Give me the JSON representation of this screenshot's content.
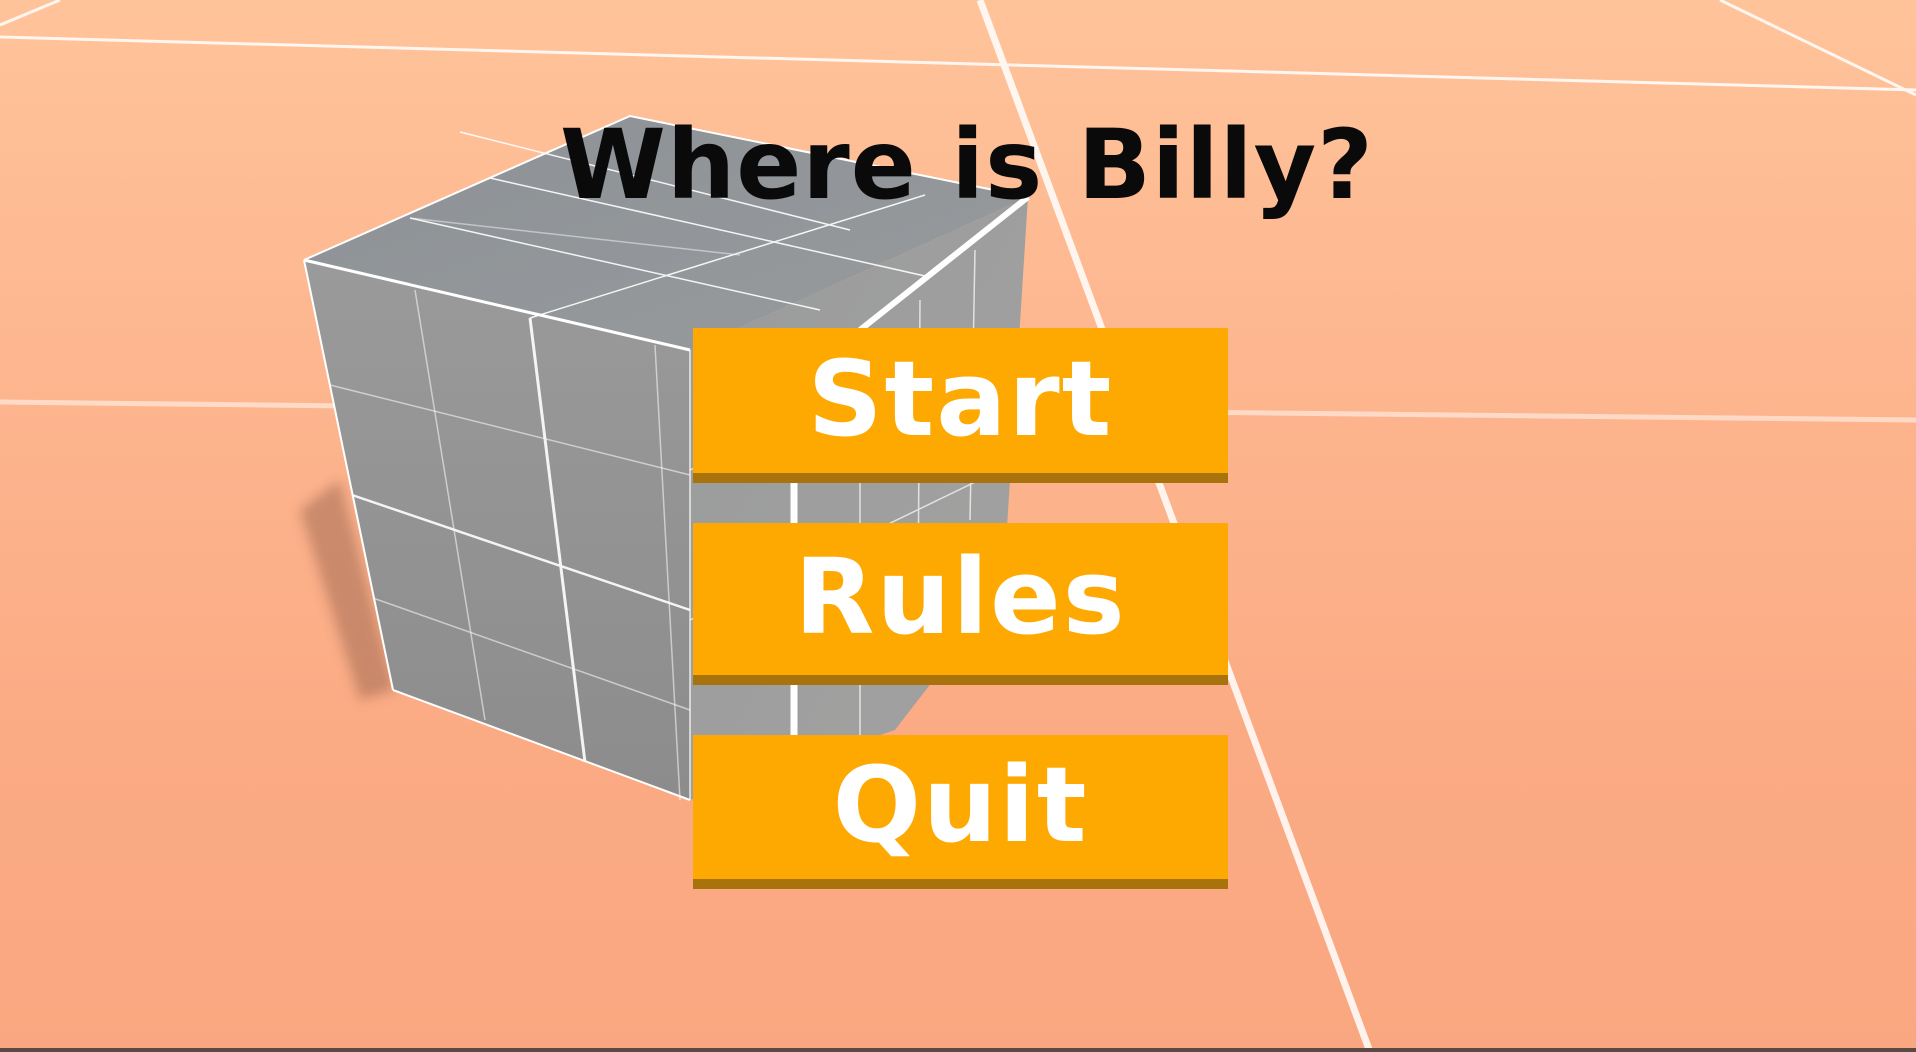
{
  "game": {
    "title": "Where is Billy?"
  },
  "menu": {
    "start_label": "Start",
    "rules_label": "Rules",
    "quit_label": "Quit"
  },
  "colors": {
    "background": "#fdb68f",
    "button_fill": "#fea802",
    "button_shadow": "#a8720c",
    "button_text": "#ffffff",
    "title_text": "#0a0a0a",
    "cube_fill": "#8f9193",
    "grid_line": "#ffffff"
  }
}
